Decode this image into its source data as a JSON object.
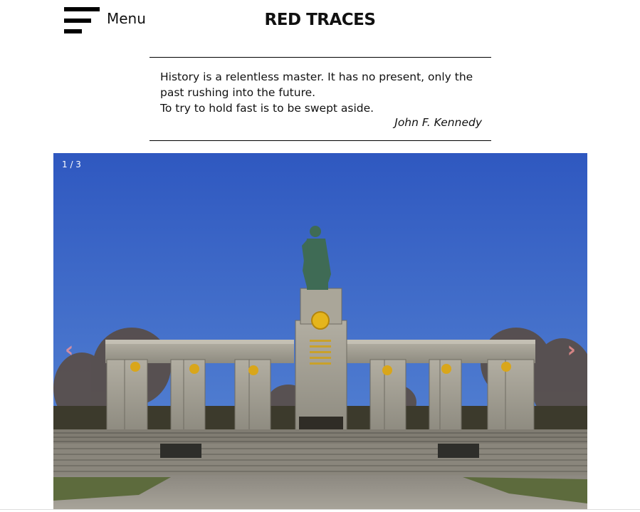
{
  "header": {
    "menu_label": "Menu",
    "site_title": "RED TRACES"
  },
  "quote": {
    "lines": [
      "History is a relentless master. It has no present, only the",
      "past rushing into the future.",
      "To try to hold fast is to be swept aside."
    ],
    "author": "John F. Kennedy"
  },
  "slideshow": {
    "counter": "1 / 3",
    "prev_icon": "chevron-left-icon",
    "next_icon": "chevron-right-icon"
  },
  "colors": {
    "sky_top": "#2f58c0",
    "sky_bottom": "#5b8ad6",
    "stone": "#9d9a8f",
    "statue": "#3f6b55",
    "gold": "#e5b51c"
  }
}
